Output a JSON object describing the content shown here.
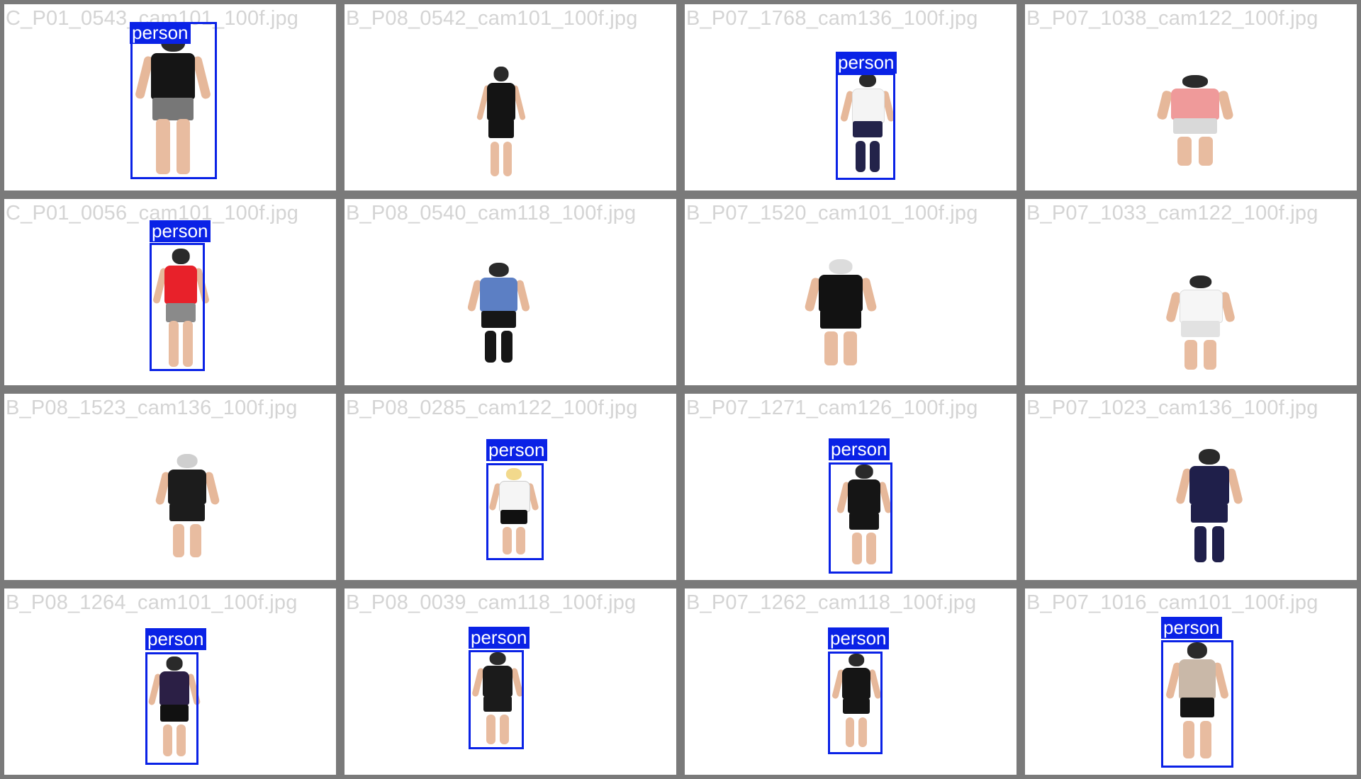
{
  "label_text": "person",
  "colors": {
    "box": "#0a22e6",
    "border": "#7a7a7a",
    "filename": "#d4d4d4"
  },
  "cells": [
    {
      "filename": "C_P01_0543_cam101_100f.jpg",
      "detected": true
    },
    {
      "filename": "B_P08_0542_cam101_100f.jpg",
      "detected": false
    },
    {
      "filename": "B_P07_1768_cam136_100f.jpg",
      "detected": true
    },
    {
      "filename": "B_P07_1038_cam122_100f.jpg",
      "detected": false
    },
    {
      "filename": "C_P01_0056_cam101_100f.jpg",
      "detected": true
    },
    {
      "filename": "B_P08_0540_cam118_100f.jpg",
      "detected": false
    },
    {
      "filename": "B_P07_1520_cam101_100f.jpg",
      "detected": false
    },
    {
      "filename": "B_P07_1033_cam122_100f.jpg",
      "detected": false
    },
    {
      "filename": "B_P08_1523_cam136_100f.jpg",
      "detected": false
    },
    {
      "filename": "B_P08_0285_cam122_100f.jpg",
      "detected": true
    },
    {
      "filename": "B_P07_1271_cam126_100f.jpg",
      "detected": true
    },
    {
      "filename": "B_P07_1023_cam136_100f.jpg",
      "detected": false
    },
    {
      "filename": "B_P08_1264_cam101_100f.jpg",
      "detected": true
    },
    {
      "filename": "B_P08_0039_cam118_100f.jpg",
      "detected": true
    },
    {
      "filename": "B_P07_1262_cam118_100f.jpg",
      "detected": true
    },
    {
      "filename": "B_P07_1016_cam101_100f.jpg",
      "detected": true
    }
  ]
}
